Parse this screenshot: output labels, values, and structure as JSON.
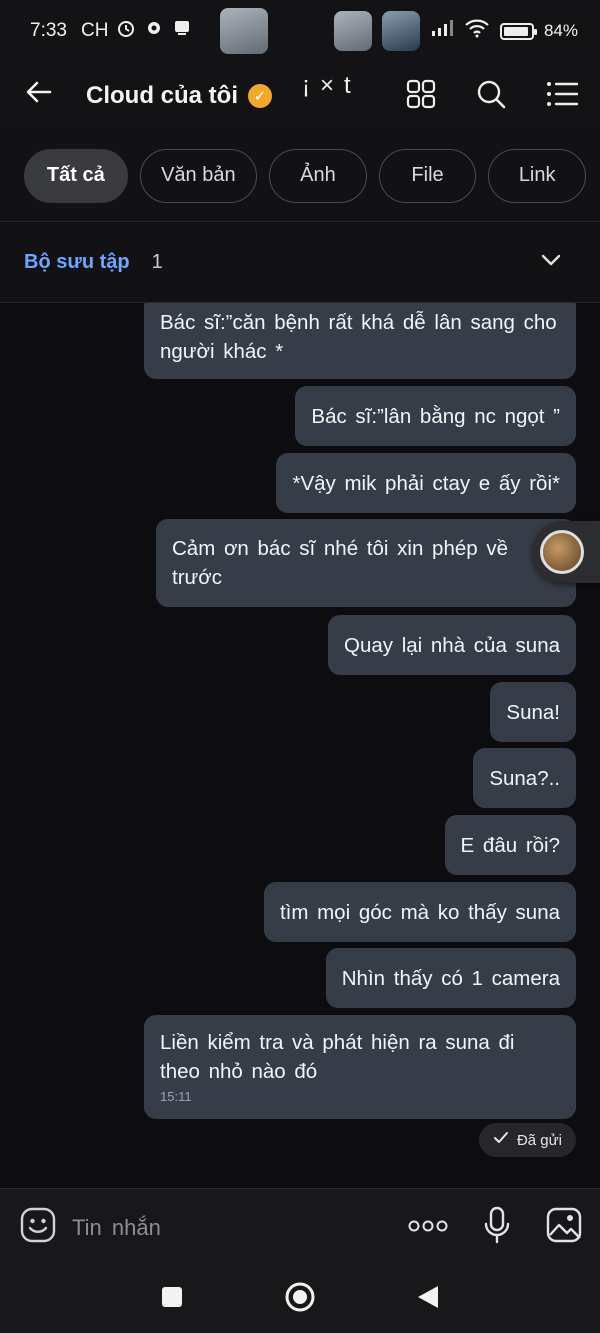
{
  "status_bar": {
    "time": "7:33",
    "period": "CH",
    "battery": "84%"
  },
  "header": {
    "title": "Cloud của tôi",
    "extra": "¡×t"
  },
  "filters": [
    {
      "label": "Tất cả",
      "active": true
    },
    {
      "label": "Văn bản",
      "active": false
    },
    {
      "label": "Ảnh",
      "active": false
    },
    {
      "label": "File",
      "active": false
    },
    {
      "label": "Link",
      "active": false
    }
  ],
  "collection": {
    "label": "Bộ sưu tập",
    "count": "1"
  },
  "messages": [
    {
      "text": "Bác sĩ:”căn bệnh rất khá dễ lân sang cho người khác *"
    },
    {
      "text": "Bác sĩ:”lân bằng nc ngọt ”"
    },
    {
      "text": "*Vậy mik phải ctay e ấy rồi*"
    },
    {
      "text": "Cảm ơn bác sĩ nhé tôi xin phép về trước"
    },
    {
      "text": "Quay lại nhà của suna"
    },
    {
      "text": "Suna!"
    },
    {
      "text": "Suna?.."
    },
    {
      "text": "E đâu rồi?"
    },
    {
      "text": "tìm mọi góc mà ko thấy suna"
    },
    {
      "text": "Nhìn thấy có 1 camera"
    },
    {
      "text": "Liền kiểm tra và phát hiện ra suna đi theo nhỏ nào đó",
      "time": "15:11"
    }
  ],
  "sent_status": "Đã gửi",
  "input": {
    "placeholder": "Tin nhắn"
  },
  "icons": {
    "back": "arrow-left-icon",
    "verified": "verified-badge-icon",
    "grid": "grid-icon",
    "search": "search-icon",
    "menu": "list-menu-icon",
    "chevron": "chevron-down-icon",
    "emoji": "emoji-icon",
    "more": "more-dots-icon",
    "mic": "microphone-icon",
    "image": "image-icon",
    "check": "check-icon"
  },
  "colors": {
    "accent": "#6fa4ff",
    "bubble": "#373d48",
    "background": "#0d0d0f",
    "verified": "#f0a72c"
  }
}
